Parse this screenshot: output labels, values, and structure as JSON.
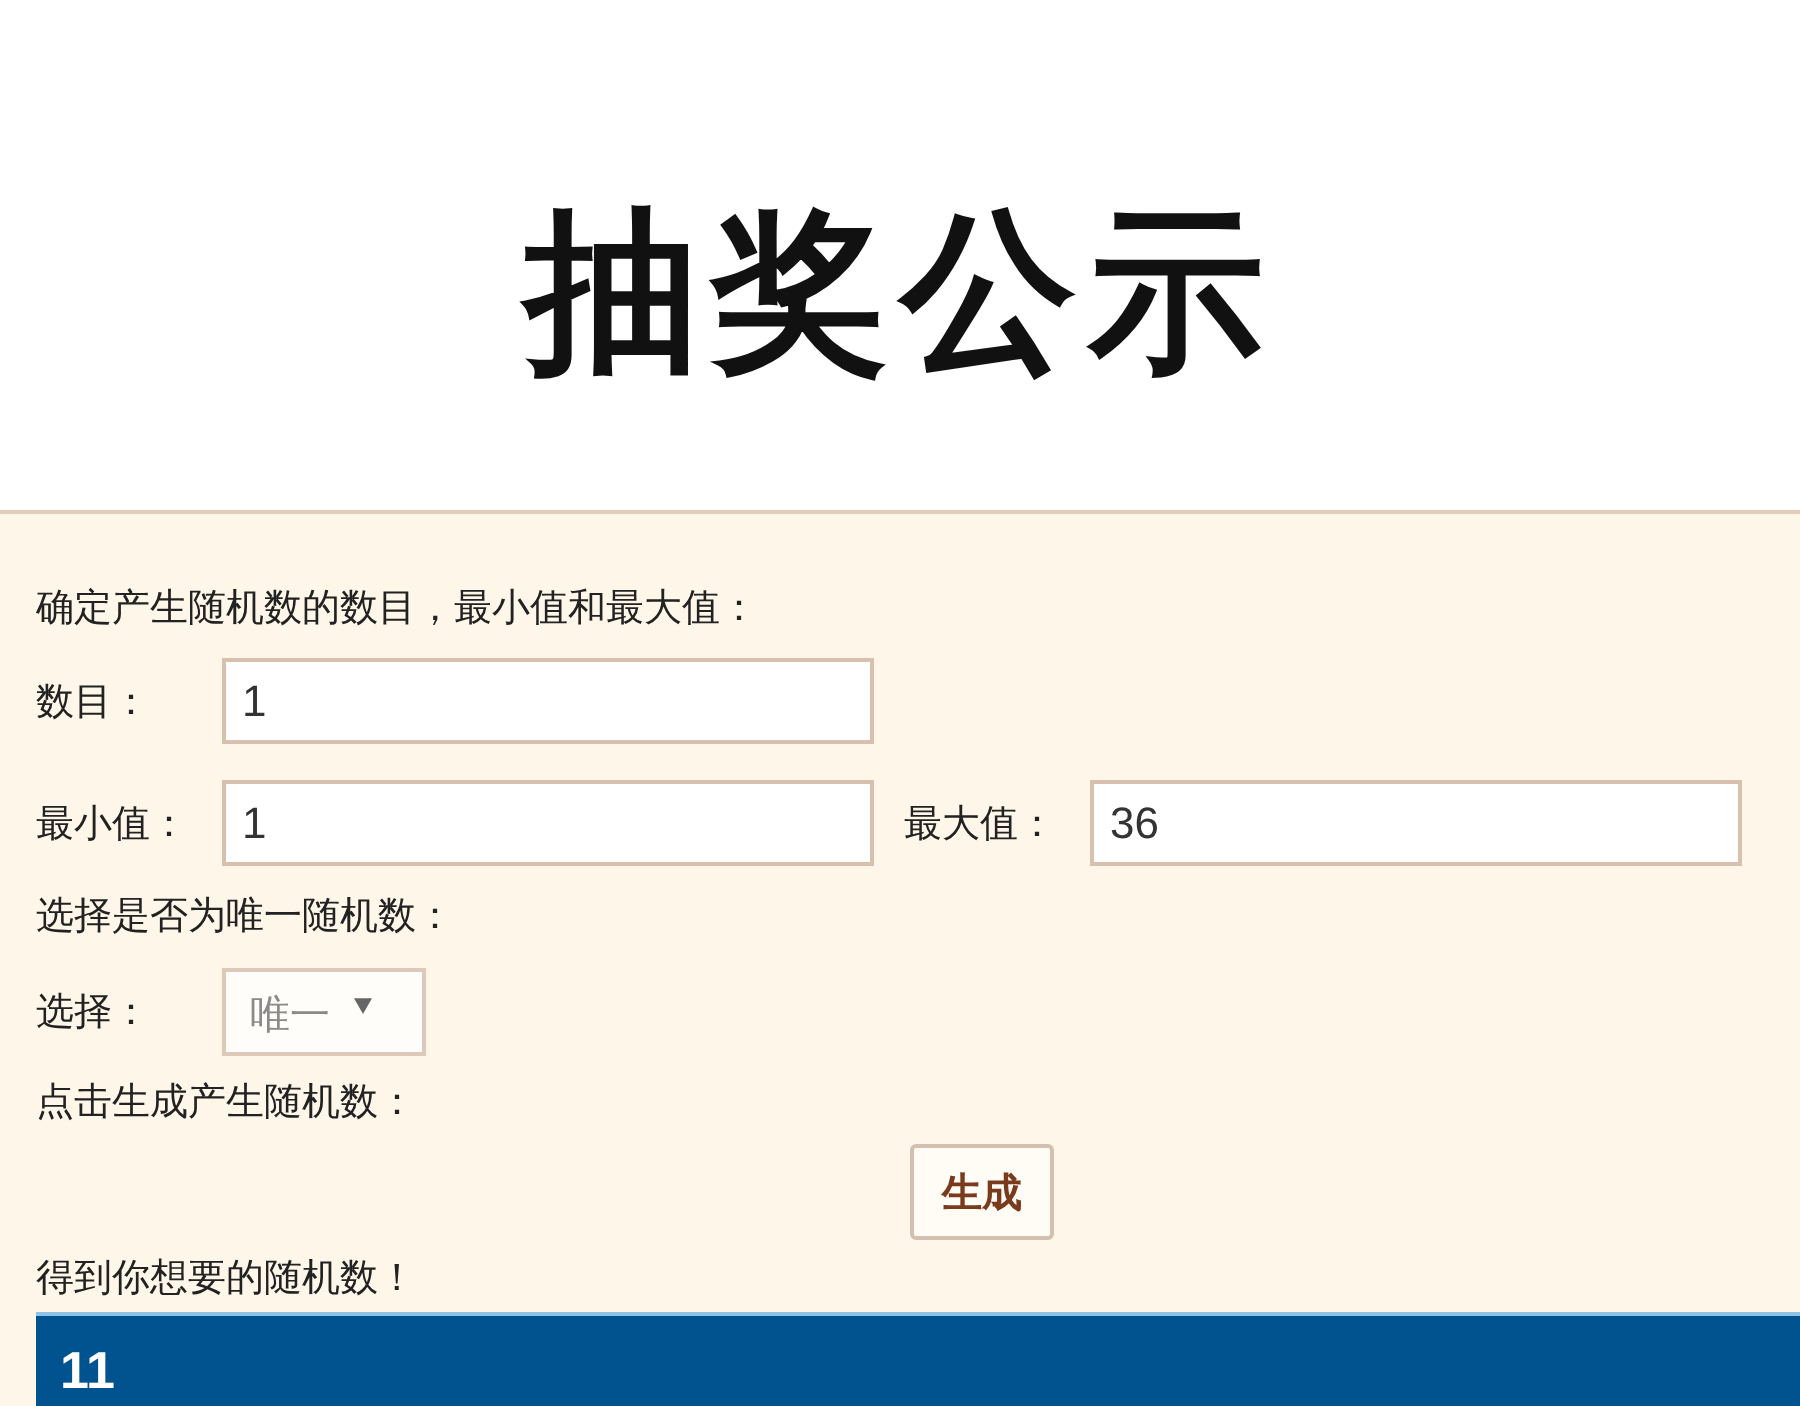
{
  "page_title": "抽奖公示",
  "range_prompt": "确定产生随机数的数目，最小值和最大值：",
  "count_field": {
    "label": "数目：",
    "value": "1"
  },
  "range_fields": [
    {
      "label": "最小值：",
      "value": "1"
    },
    {
      "label": "最大值：",
      "value": "36"
    }
  ],
  "unique_prompt": "选择是否为唯一随机数：",
  "unique_select": {
    "label": "选择：",
    "value": "唯一"
  },
  "generate_prompt": "点击生成产生随机数：",
  "generate_button": "生成",
  "result_prompt": "得到你想要的随机数！",
  "result": "11"
}
